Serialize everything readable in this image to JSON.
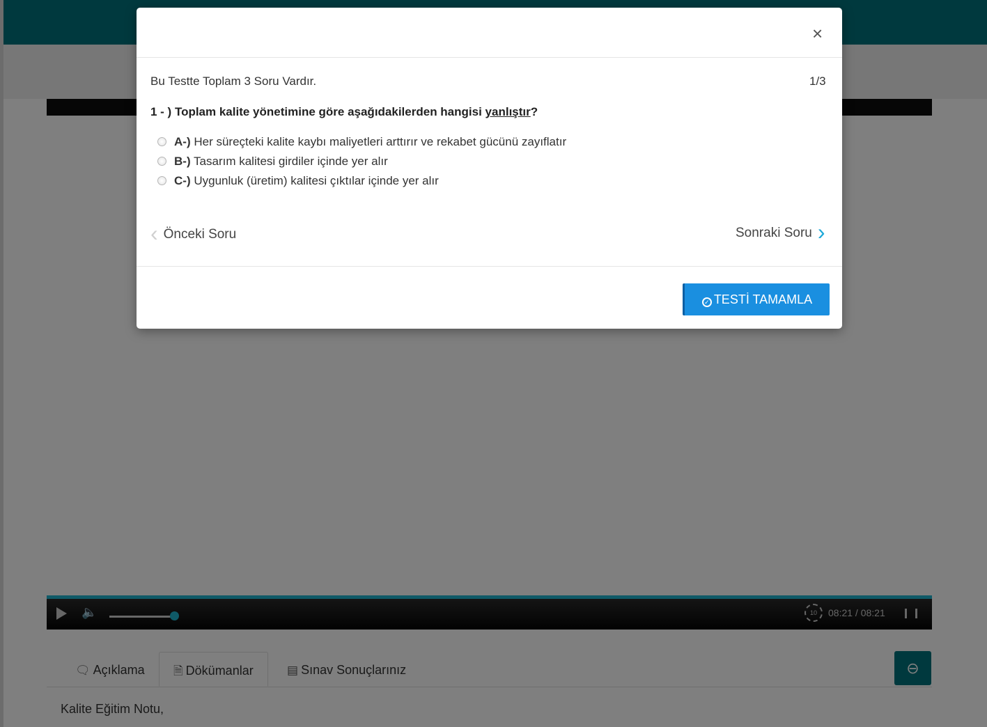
{
  "background_page": {
    "player": {
      "time": "08:21 / 08:21",
      "replay_label": "10"
    },
    "tabs": [
      {
        "label": "Açıklama",
        "icon": "comment-icon"
      },
      {
        "label": "Dökümanlar",
        "icon": "document-icon"
      },
      {
        "label": "Sınav Sonuçlarınız",
        "icon": "id-card-icon"
      }
    ],
    "note": "Kalite Eğitim Notu,"
  },
  "modal": {
    "close_label": "×",
    "total_text": "Bu Testte Toplam 3 Soru Vardır.",
    "counter": "1/3",
    "question": {
      "prefix": "1 - ) Toplam kalite yönetimine göre aşağıdakilerden hangisi ",
      "emphasis": "yanlıştır",
      "suffix": "?"
    },
    "options": [
      {
        "key": "A-)",
        "text": "Her süreçteki kalite kaybı maliyetleri arttırır ve rekabet gücünü zayıflatır"
      },
      {
        "key": "B-)",
        "text": "Tasarım kalitesi girdiler içinde yer alır"
      },
      {
        "key": "C-)",
        "text": "Uygunluk (üretim) kalitesi çıktılar içinde yer alır"
      }
    ],
    "prev_label": "Önceki Soru",
    "next_label": "Sonraki Soru",
    "complete_label": "TESTİ TAMAMLA"
  },
  "colors": {
    "header": "#00737d",
    "progress": "#1fb5cf",
    "primary_button": "#1a8fe0",
    "next_chevron": "#1ea9d8"
  }
}
